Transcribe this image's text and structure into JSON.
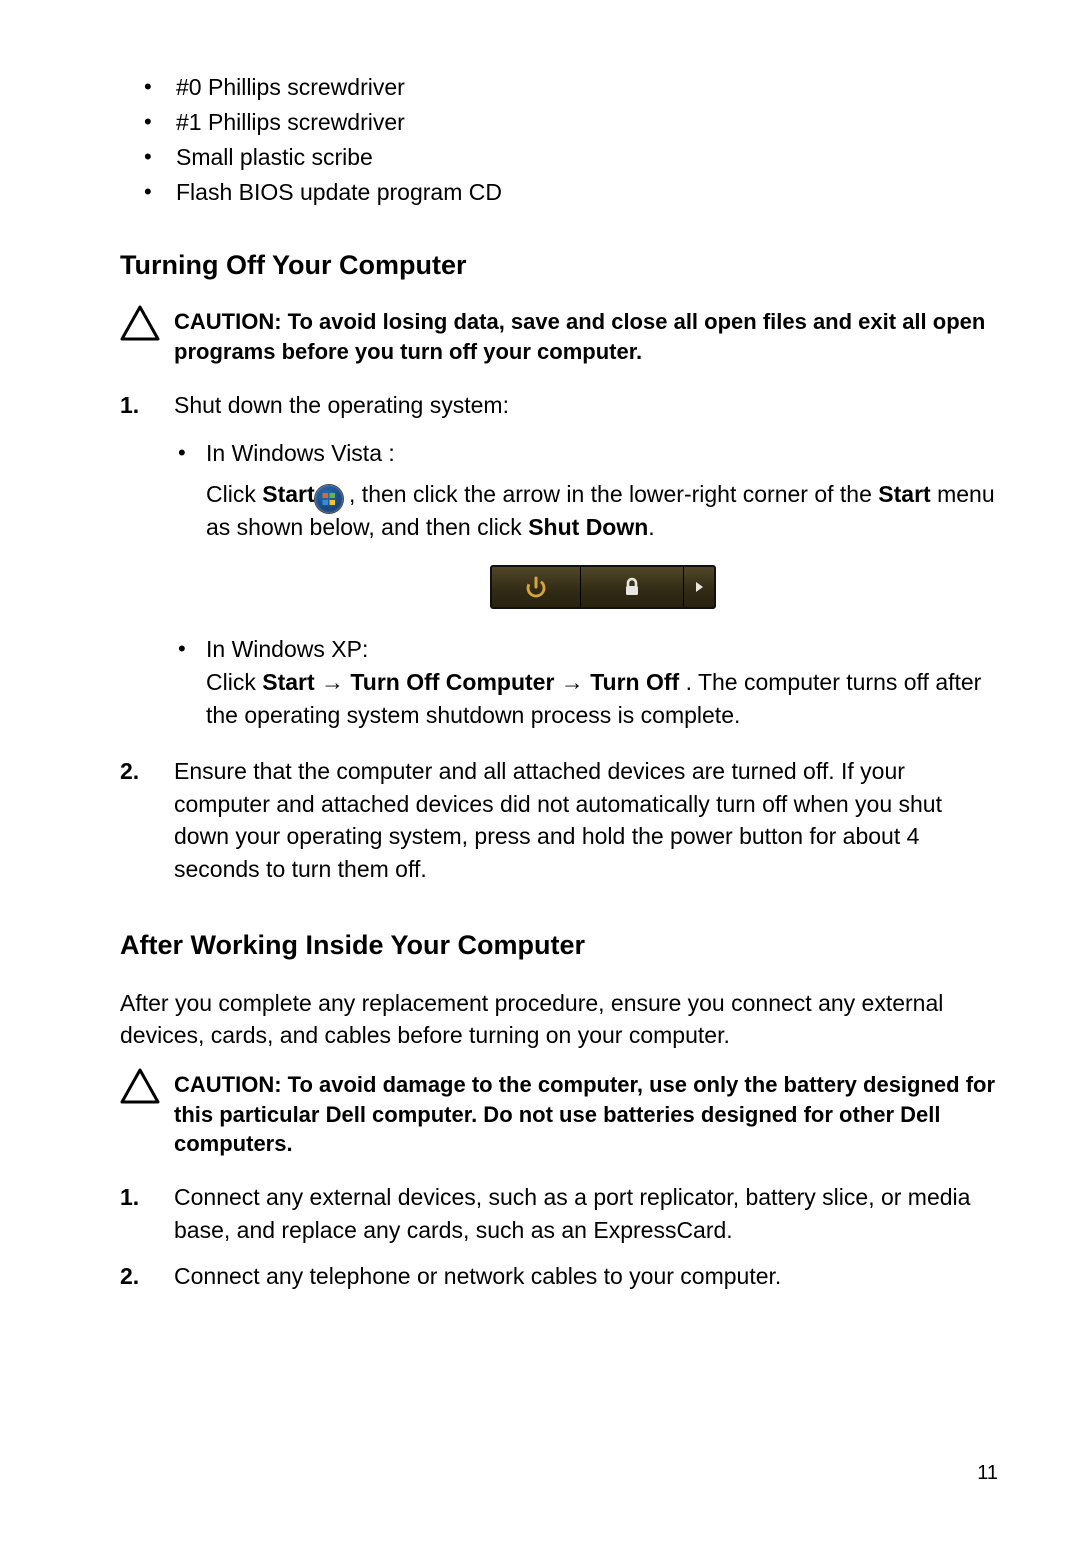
{
  "tools": [
    "#0 Phillips screwdriver",
    "#1 Phillips screwdriver",
    "Small plastic scribe",
    "Flash BIOS update program CD"
  ],
  "section1": {
    "title": "Turning Off Your Computer",
    "caution_lead": "CAUTION: ",
    "caution_body": "To avoid losing data, save and close all open files and exit all open programs before you turn off your computer.",
    "step1": "Shut down the operating system:",
    "vista_head": "In Windows Vista :",
    "vista_click": "Click ",
    "vista_start": "Start",
    "vista_after_icon": " , then click the arrow in the lower-right corner of the ",
    "vista_menu_word": "Start",
    "vista_continue": " menu as shown below, and then click ",
    "vista_shutdown": "Shut Down",
    "vista_period": ".",
    "xp_head": "In Windows XP:",
    "xp_click": "Click ",
    "xp_start": "Start",
    "xp_arrow1": " → ",
    "xp_turnoffcomp": "Turn Off Computer",
    "xp_arrow2": " → ",
    "xp_turnoff": "Turn Off",
    "xp_after": " . The computer turns off after the operating system shutdown process is complete.",
    "step2": "Ensure that the computer and all attached devices are turned off. If your computer and attached devices did not automatically turn off when you shut down your operating system, press and hold the power button for about 4 seconds to turn them off."
  },
  "section2": {
    "title": "After Working Inside Your Computer",
    "intro": "After you complete any replacement procedure, ensure you connect any external devices, cards, and cables before turning on your computer.",
    "caution_lead": "CAUTION: ",
    "caution_body": "To avoid damage to the computer, use only the battery designed for this particular Dell computer. Do not use batteries designed for other Dell computers.",
    "step1": "Connect any external devices, such as a port replicator, battery slice, or media base, and replace any cards, such as an ExpressCard.",
    "step2": "Connect any telephone or network cables to your computer."
  },
  "page_number": "11"
}
